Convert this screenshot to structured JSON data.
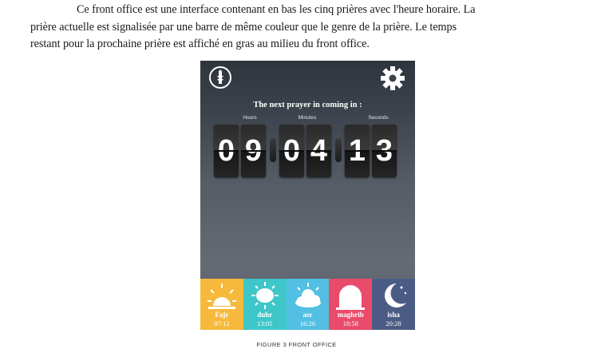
{
  "document": {
    "paragraph_line1": "Ce front office est une interface contenant en bas les cinq prières avec l'heure horaire.  La",
    "paragraph_line2": "prière actuelle est signalisée par une barre de même couleur que le genre de la prière.  Le temps",
    "paragraph_line3": "restant pour la prochaine prière est affiché en gras au milieu du front office.",
    "caption": "FIGURE 3 FRONT OFFICE"
  },
  "app": {
    "next_prayer_title": "The next prayer in coming in :",
    "units": {
      "hours": "Hours",
      "minutes": "Minutes",
      "seconds": "Seconds"
    },
    "digits": [
      "0",
      "9",
      "0",
      "4",
      "1",
      "3"
    ],
    "icons": {
      "top_left": "minaret-icon",
      "top_right": "gear-icon"
    },
    "prayers": [
      {
        "name": "Fajr",
        "time": "07:12",
        "color": "#f6b93b",
        "icon": "sunrise-icon"
      },
      {
        "name": "duhr",
        "time": "13:05",
        "color": "#3ec6c9",
        "icon": "sun-icon"
      },
      {
        "name": "asr",
        "time": "16:26",
        "color": "#52bfe3",
        "icon": "cloud-sun-icon"
      },
      {
        "name": "maghrib",
        "time": "18:58",
        "color": "#ea4b6a",
        "icon": "sunset-icon"
      },
      {
        "name": "isha",
        "time": "20:28",
        "color": "#4b5c84",
        "icon": "moon-icon"
      }
    ]
  }
}
